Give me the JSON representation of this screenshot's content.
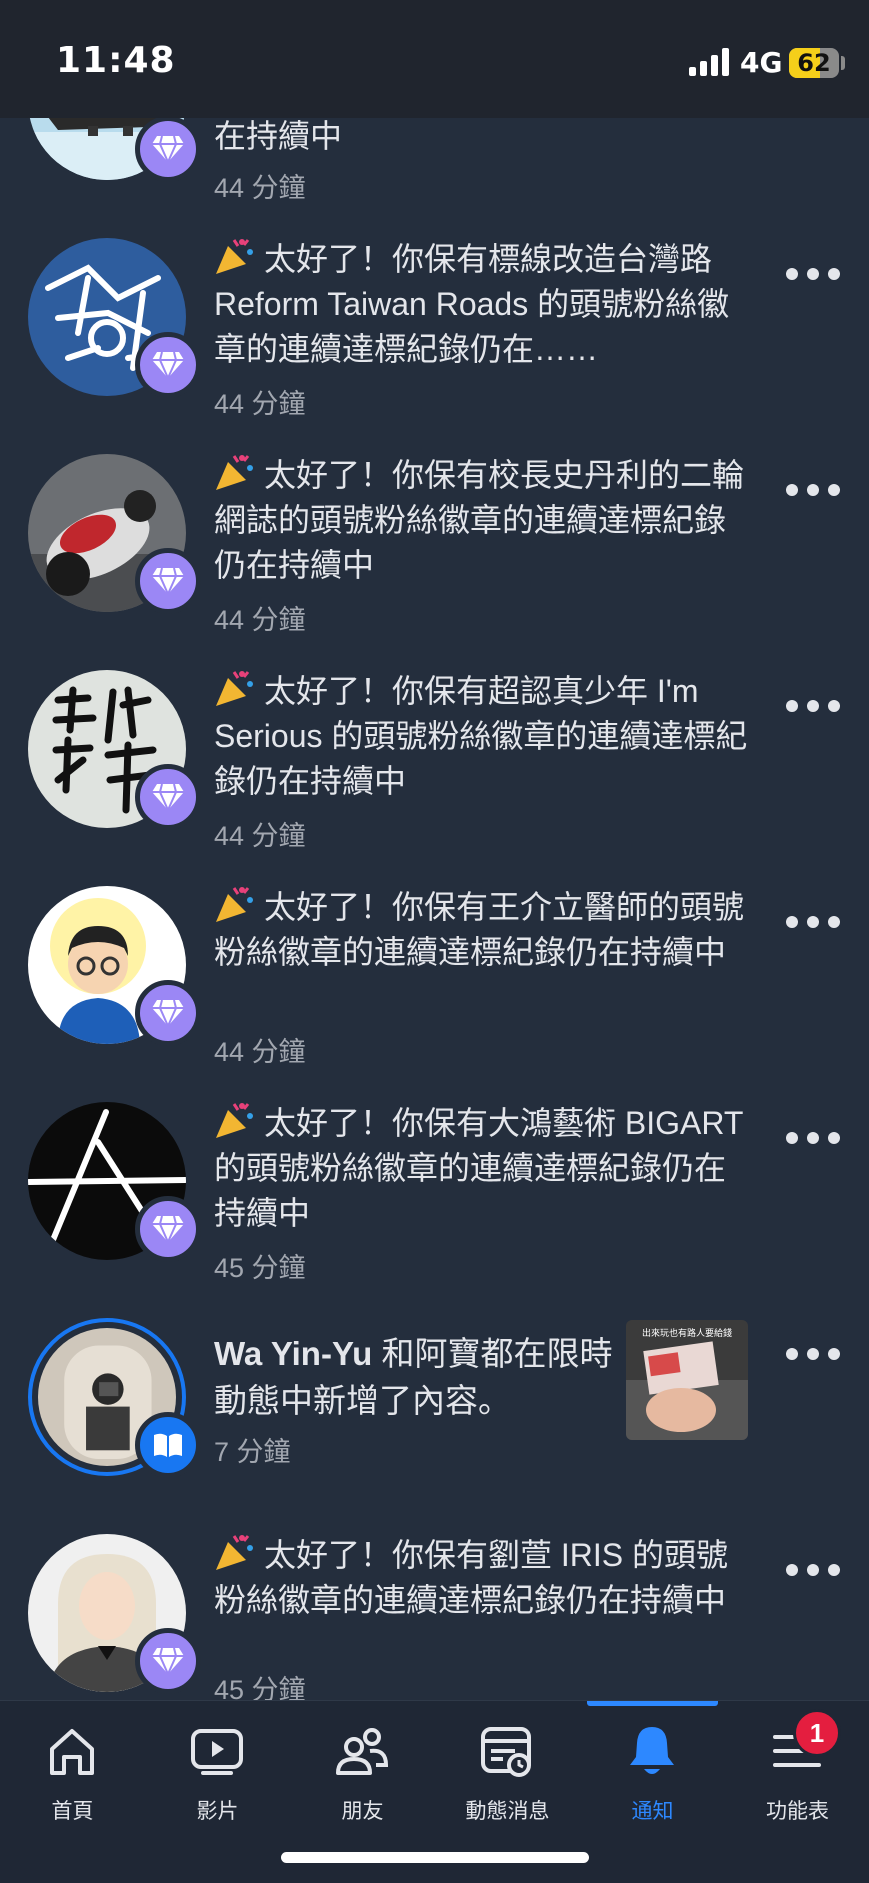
{
  "status_bar": {
    "time": "11:48",
    "network": "4G",
    "battery": "62",
    "battery_level": 0.62
  },
  "notifications": [
    {
      "id": "n1",
      "text": "在持續中",
      "time": "44 分鐘",
      "avatar": "airplane-photo",
      "badge": "diamond-icon",
      "has_menu": false
    },
    {
      "id": "n2",
      "text": "太好了！你保有標線改造台灣路 Reform Taiwan Roads 的頭號粉絲徽章的連續達標紀錄仍在……",
      "time": "44 分鐘",
      "avatar": "road-logo",
      "badge": "diamond-icon",
      "has_menu": true
    },
    {
      "id": "n3",
      "text": "太好了！你保有校長史丹利的二輪網誌的頭號粉絲徽章的連續達標紀錄仍在持續中",
      "time": "44 分鐘",
      "avatar": "motorcycle-photo",
      "badge": "diamond-icon",
      "has_menu": true
    },
    {
      "id": "n4",
      "text": "太好了！你保有超認真少年 I'm Serious 的頭號粉絲徽章的連續達標紀錄仍在持續中",
      "time": "44 分鐘",
      "avatar": "calligraphy-logo",
      "badge": "diamond-icon",
      "has_menu": true
    },
    {
      "id": "n5",
      "text": "太好了！你保有王介立醫師的頭號粉絲徽章的連續達標紀錄仍在持續中",
      "time": "44 分鐘",
      "avatar": "cartoon-doctor",
      "badge": "diamond-icon",
      "has_menu": true
    },
    {
      "id": "n6",
      "text": "太好了！你保有大鴻藝術 BIGART 的頭號粉絲徽章的連續達標紀錄仍在持續中",
      "time": "45 分鐘",
      "avatar": "bigart-logo",
      "badge": "diamond-icon",
      "has_menu": true
    },
    {
      "id": "n7",
      "strong": "Wa Yin-Yu",
      "text": " 和阿寶都在限時動態中新增了內容。",
      "time": "7 分鐘",
      "avatar": "selfie-photo",
      "badge": "book-icon",
      "thumb_caption": "出來玩也有路人要給錢",
      "has_menu": true
    },
    {
      "id": "n8",
      "text": "太好了！你保有劉萱 IRIS 的頭號粉絲徽章的連續達標紀錄仍在持續中",
      "time": "45 分鐘",
      "avatar": "portrait-photo",
      "badge": "diamond-icon",
      "has_menu": true
    }
  ],
  "tabbar": {
    "tabs": [
      {
        "label": "首頁",
        "icon": "home-icon"
      },
      {
        "label": "影片",
        "icon": "video-icon"
      },
      {
        "label": "朋友",
        "icon": "friends-icon"
      },
      {
        "label": "動態消息",
        "icon": "feed-icon"
      },
      {
        "label": "通知",
        "icon": "bell-icon",
        "active": true
      },
      {
        "label": "功能表",
        "icon": "menu-icon",
        "badge": "1"
      }
    ]
  },
  "colors": {
    "background": "#242e3d",
    "accent": "#2d88ff",
    "badge_purple": "#9b87f5",
    "alert_red": "#e41e3f"
  }
}
